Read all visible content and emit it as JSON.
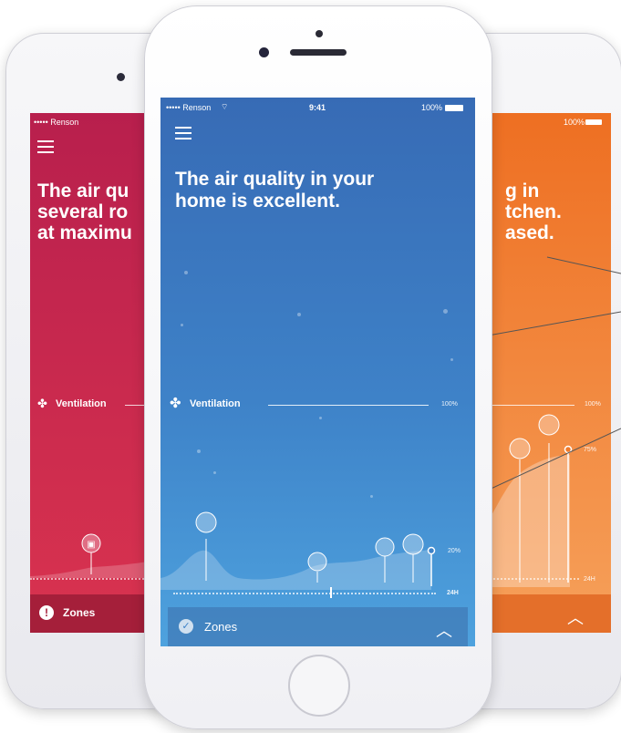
{
  "left_phone": {
    "carrier": "••••• Renson",
    "headline_lines": [
      "The air qu",
      "several ro",
      "at maximu"
    ],
    "ventilation_label": "Ventilation",
    "zones_label": "Zones",
    "color": "#c9244e"
  },
  "center_phone": {
    "carrier": "••••• Renson",
    "time": "9:41",
    "battery": "100%",
    "headline_lines": [
      "The air quality in your",
      "home is excellent."
    ],
    "ventilation_label": "Ventilation",
    "pct_top": "100%",
    "pct_bottom": "20%",
    "time_range": "24H",
    "zones_label": "Zones",
    "color_top": "#3b6fb8",
    "color_bottom": "#4aa0dc"
  },
  "right_phone": {
    "battery": "100%",
    "headline_lines": [
      "g in",
      "tchen.",
      "ased."
    ],
    "pct_top": "100%",
    "pct_mid": "75%",
    "time_range": "24H",
    "color": "#f07a2a"
  },
  "icons": {
    "ventilation": "fan-icon",
    "status_ok": "check-circle-icon",
    "status_alert": "exclamation-circle-icon",
    "expand": "chevron-up-icon",
    "menu": "hamburger-icon"
  }
}
